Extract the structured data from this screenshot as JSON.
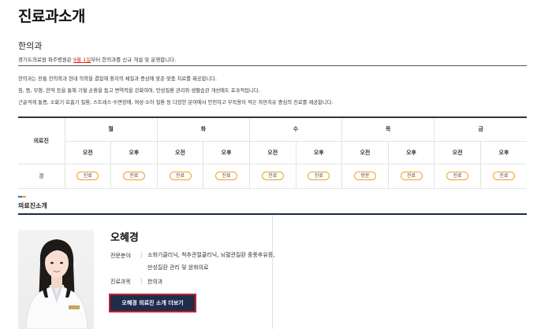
{
  "page": {
    "title": "진료과소개"
  },
  "department": {
    "name": "한의과",
    "notice_prefix": "경기도의료원 파주병원은 ",
    "notice_date": "9월 1일",
    "notice_suffix": "부터 한의과를 신규 개설 및 운영합니다.",
    "descriptions": [
      "한의과는 전통 한의학과 현대 의학을 결합해 환자의 체질과 증상에 맞춘 맞춤 치료를 제공합니다.",
      "침, 뜸, 부항, 한약 등을 통해 기혈 순환을 돕고 면역력을 강화하며, 만성질환 관리와 생활습관 개선에도 효과적입니다.",
      "근골격계 통증, 소화기·호흡기 질환, 스트레스·수면장애, 여성·소아 질환 등 다양한 분야에서 안전하고 부작용이 적은 자연치유 중심의 진료를 제공합니다."
    ]
  },
  "schedule": {
    "doctor_col_label": "의료진",
    "days": [
      "월",
      "화",
      "수",
      "목",
      "금"
    ],
    "am_label": "오전",
    "pm_label": "오후",
    "rows": [
      {
        "doctor": "경",
        "slots": [
          "진료",
          "진료",
          "진료",
          "진료",
          "진료",
          "진료",
          "방문",
          "진료",
          "진료",
          "진료"
        ]
      }
    ]
  },
  "staff_section": {
    "label": "의료진소개",
    "doctor": {
      "name": "오혜경",
      "specialty_label": "전문분야",
      "specialty_value": "소화기클리닉, 척추관절클리닉, 뇌혈관질환 중풍후유증, 만성질환 관리 및 완화의료",
      "dept_label": "진료과목",
      "dept_value": "한의과",
      "more_button": "오혜경 의료진 소개 더보기"
    }
  },
  "colors": {
    "accent_orange": "#f2a01e",
    "notice_red": "#e0231f",
    "button_navy": "#1f2c4d",
    "button_border": "#c8202a"
  }
}
